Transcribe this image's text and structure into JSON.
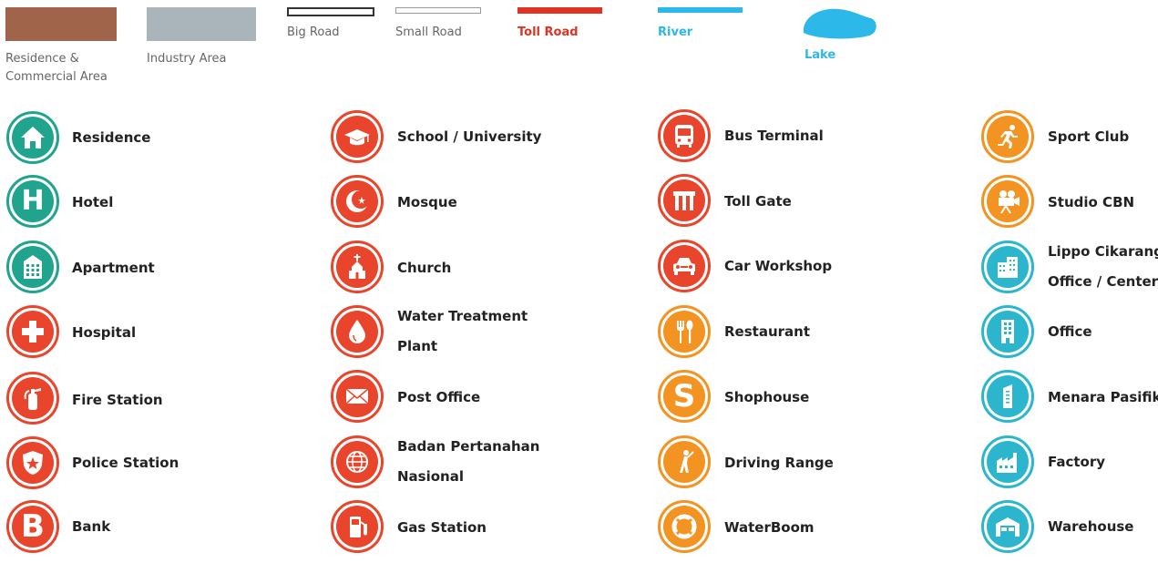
{
  "colors": {
    "teal": "#20a48e",
    "red": "#e8452c",
    "orange": "#f39321",
    "cyan": "#2bb6cd",
    "residence_area": "#a0644a",
    "industry_area": "#a9b4bb",
    "toll_road": "#e03323",
    "river": "#2cb8e8",
    "lake": "#2cb8e8"
  },
  "area_legend": [
    {
      "label": "Residence &\nCommercial Area",
      "label_l1": "Residence &",
      "label_l2": "Commercial Area"
    },
    {
      "label": "Industry Area"
    },
    {
      "label": "Big Road"
    },
    {
      "label": "Small Road"
    },
    {
      "label": "Toll Road"
    },
    {
      "label": "River"
    },
    {
      "label": "Lake"
    }
  ],
  "columns": [
    {
      "items": [
        {
          "label": "Residence",
          "icon": "house-icon"
        },
        {
          "label": "Hotel",
          "icon": "hotel-icon"
        },
        {
          "label": "Apartment",
          "icon": "apartment-icon"
        },
        {
          "label": "Hospital",
          "icon": "hospital-icon"
        },
        {
          "label": "Fire Station",
          "icon": "fire-extinguisher-icon"
        },
        {
          "label": "Police Station",
          "icon": "police-badge-icon"
        },
        {
          "label": "Bank",
          "icon": "bank-icon"
        }
      ]
    },
    {
      "items": [
        {
          "label": "School / University",
          "icon": "graduation-cap-icon"
        },
        {
          "label": "Mosque",
          "icon": "crescent-star-icon"
        },
        {
          "label": "Church",
          "icon": "church-icon"
        },
        {
          "label": "Water Treatment",
          "label2": "Plant",
          "icon": "water-drop-icon"
        },
        {
          "label": "Post Office",
          "icon": "envelope-icon"
        },
        {
          "label": "Badan Pertanahan",
          "label2": "Nasional",
          "icon": "globe-icon"
        },
        {
          "label": "Gas Station",
          "icon": "fuel-pump-icon"
        }
      ]
    },
    {
      "items": [
        {
          "label": "Bus Terminal",
          "icon": "bus-icon"
        },
        {
          "label": "Toll Gate",
          "icon": "toll-gate-icon"
        },
        {
          "label": "Car Workshop",
          "icon": "car-icon"
        },
        {
          "label": "Restaurant",
          "icon": "fork-spoon-icon"
        },
        {
          "label": "Shophouse",
          "icon": "shophouse-icon"
        },
        {
          "label": "Driving Range",
          "icon": "golfer-icon"
        },
        {
          "label": "WaterBoom",
          "icon": "lifebuoy-icon"
        }
      ]
    },
    {
      "items": [
        {
          "label": "Sport Club",
          "icon": "runner-icon"
        },
        {
          "label": "Studio CBN",
          "icon": "movie-camera-icon"
        },
        {
          "label": "Lippo Cikarang",
          "label2": "Office / Center",
          "icon": "office-building-icon"
        },
        {
          "label": "Office",
          "icon": "tower-icon"
        },
        {
          "label": "Menara Pasifik",
          "icon": "skyscraper-icon"
        },
        {
          "label": "Factory",
          "icon": "factory-icon"
        },
        {
          "label": "Warehouse",
          "icon": "warehouse-icon"
        }
      ]
    }
  ]
}
